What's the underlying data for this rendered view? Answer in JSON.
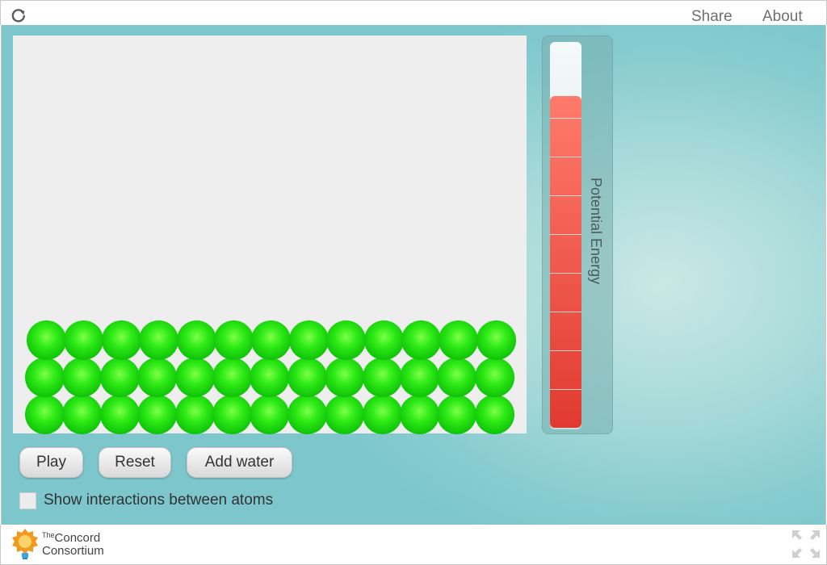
{
  "topbar": {
    "share_label": "Share",
    "about_label": "About"
  },
  "model": {
    "atom_color": "#22dd11",
    "atom_rows": 3,
    "atoms_per_row": 13
  },
  "energy_bar": {
    "label": "Potential Energy",
    "fill_fraction": 0.856,
    "fill_color": "#e8473c"
  },
  "controls": {
    "play_label": "Play",
    "reset_label": "Reset",
    "add_water_label": "Add water",
    "show_interactions_label": "Show interactions between atoms",
    "show_interactions_checked": false
  },
  "footer": {
    "logo_small": "The",
    "logo_line1": "Concord",
    "logo_line2": "Consortium"
  },
  "icons": {
    "reload": "reload-icon",
    "fullscreen": "fullscreen-icon",
    "logo": "lightbulb-logo-icon"
  }
}
